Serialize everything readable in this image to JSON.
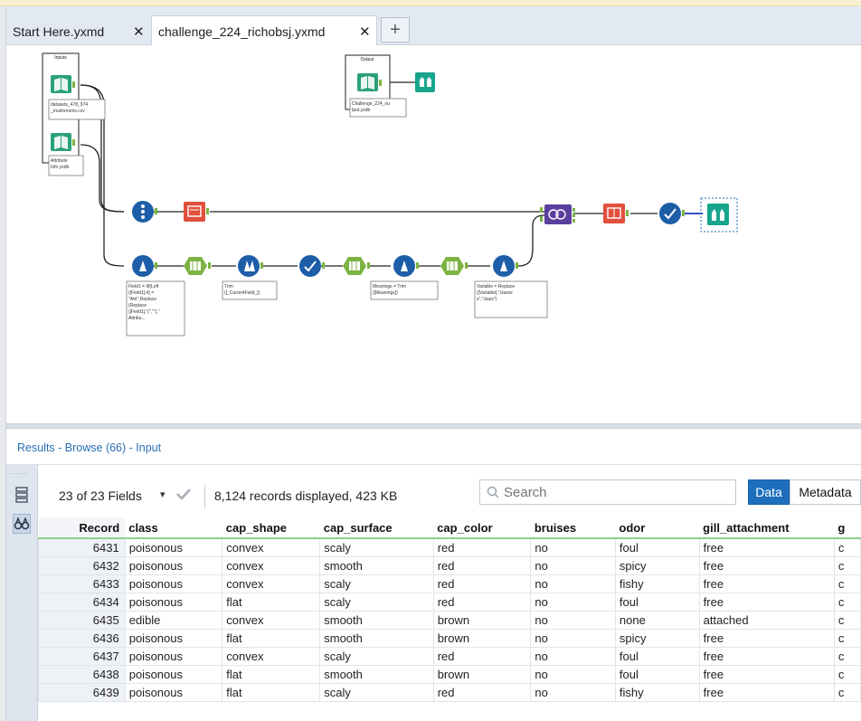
{
  "tabs": [
    {
      "label": "Start Here.yxmd",
      "close": "✕"
    },
    {
      "label": "challenge_224_richobsj.yxmd",
      "close": "✕"
    }
  ],
  "new_tab": "+",
  "canvas": {
    "containers": [
      {
        "title": "Inputs"
      },
      {
        "title": "Output"
      }
    ],
    "annotations": {
      "input1": [
        "datasets_478_974",
        "_mushrooms.csv"
      ],
      "input2": [
        "Attribute",
        "Info.yxdb"
      ],
      "output": [
        "Challenge_224_ou",
        "tput.yxdb"
      ],
      "formula1": [
        "Field1 = IIf(Left",
        "([Field1],4) =",
        "\"Attr\",Replace",
        "(Replace",
        "([Field1],\"(\",\"\"),\"",
        "Attribu..."
      ],
      "formula2": [
        "Trim",
        "([_CurrentField_])"
      ],
      "formula3": [
        "Meanings = Trim",
        "([Meanings])"
      ],
      "formula4": [
        "Variable = Replace",
        "([Variable],\"classe",
        "s\",\"class\")"
      ]
    },
    "colors": {
      "input_green": "#2aa17d",
      "blue_tool": "#1e5ea8",
      "select_green": "#7cb342",
      "red_tool": "#e0503d",
      "join_purple": "#5b3f9e",
      "browse_teal": "#17a58c"
    }
  },
  "results": {
    "title": "Results - Browse (66) - Input",
    "fields_label": "23 of 23 Fields",
    "fields_dropdown": "▾",
    "records_text": "8,124 records displayed, 423 KB",
    "search_placeholder": "Search",
    "data_button": "Data",
    "metadata_button": "Metadata",
    "columns": [
      "Record",
      "class",
      "cap_shape",
      "cap_surface",
      "cap_color",
      "bruises",
      "odor",
      "gill_attachment",
      "g"
    ],
    "rows": [
      [
        "6431",
        "poisonous",
        "convex",
        "scaly",
        "red",
        "no",
        "foul",
        "free",
        "c"
      ],
      [
        "6432",
        "poisonous",
        "convex",
        "smooth",
        "red",
        "no",
        "spicy",
        "free",
        "c"
      ],
      [
        "6433",
        "poisonous",
        "convex",
        "scaly",
        "red",
        "no",
        "fishy",
        "free",
        "c"
      ],
      [
        "6434",
        "poisonous",
        "flat",
        "scaly",
        "red",
        "no",
        "foul",
        "free",
        "c"
      ],
      [
        "6435",
        "edible",
        "convex",
        "smooth",
        "brown",
        "no",
        "none",
        "attached",
        "c"
      ],
      [
        "6436",
        "poisonous",
        "flat",
        "smooth",
        "brown",
        "no",
        "spicy",
        "free",
        "c"
      ],
      [
        "6437",
        "poisonous",
        "convex",
        "scaly",
        "red",
        "no",
        "foul",
        "free",
        "c"
      ],
      [
        "6438",
        "poisonous",
        "flat",
        "smooth",
        "brown",
        "no",
        "foul",
        "free",
        "c"
      ],
      [
        "6439",
        "poisonous",
        "flat",
        "scaly",
        "red",
        "no",
        "fishy",
        "free",
        "c"
      ]
    ]
  }
}
